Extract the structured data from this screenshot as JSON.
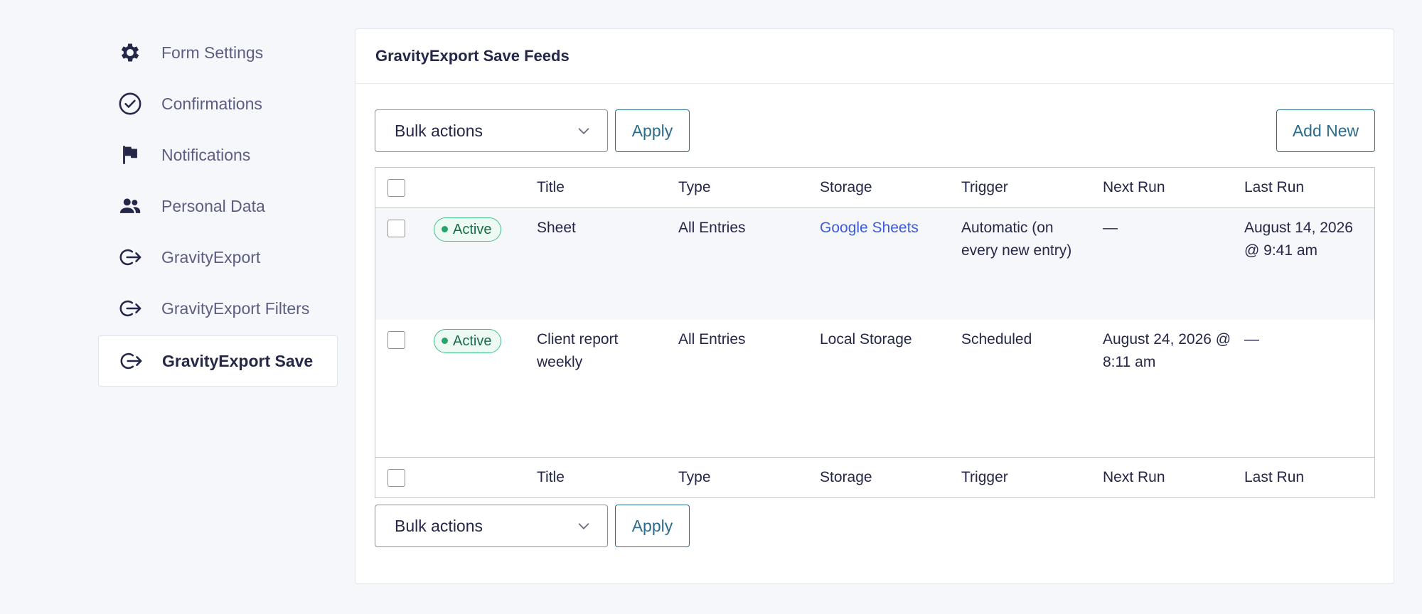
{
  "sidebar": {
    "items": [
      {
        "label": "Form Settings",
        "icon": "gear-icon"
      },
      {
        "label": "Confirmations",
        "icon": "check-circle-icon"
      },
      {
        "label": "Notifications",
        "icon": "flag-icon"
      },
      {
        "label": "Personal Data",
        "icon": "people-icon"
      },
      {
        "label": "GravityExport",
        "icon": "export-arrow-icon"
      },
      {
        "label": "GravityExport Filters",
        "icon": "export-arrow-icon"
      },
      {
        "label": "GravityExport Save",
        "icon": "export-arrow-icon",
        "active": true
      }
    ]
  },
  "panel": {
    "title": "GravityExport Save Feeds",
    "bulk_actions": "Bulk actions",
    "apply": "Apply",
    "add_new": "Add New"
  },
  "table": {
    "columns": [
      "Title",
      "Type",
      "Storage",
      "Trigger",
      "Next Run",
      "Last Run"
    ],
    "rows": [
      {
        "status": "Active",
        "title": "Sheet",
        "type": "All Entries",
        "storage": "Google Sheets",
        "trigger": "Automatic (on every new entry)",
        "next_run": "—",
        "last_run": "August 14, 2026 @ 9:41 am"
      },
      {
        "status": "Active",
        "title": "Client report weekly",
        "type": "All Entries",
        "storage": "Local Storage",
        "trigger": "Scheduled",
        "next_run": "August 24, 2026 @ 8:11 am",
        "last_run": "—"
      }
    ]
  },
  "colors": {
    "accent": "#2b6b8c",
    "link": "#3d5bd9",
    "active_badge": "#3fbf85",
    "background": "#f5f7fb"
  }
}
